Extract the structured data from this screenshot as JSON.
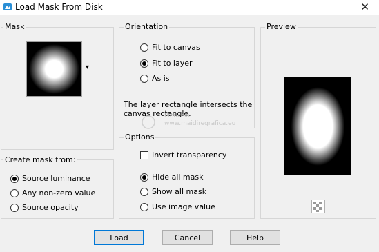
{
  "window": {
    "title": "Load Mask From Disk",
    "close_glyph": "✕"
  },
  "mask_group": {
    "label": "Mask",
    "dropdown_glyph": "▾"
  },
  "create_mask": {
    "label": "Create mask from:",
    "options": [
      {
        "label": "Source luminance",
        "selected": true
      },
      {
        "label": "Any non-zero value",
        "selected": false
      },
      {
        "label": "Source opacity",
        "selected": false
      }
    ]
  },
  "orientation": {
    "label": "Orientation",
    "options": [
      {
        "label": "Fit to canvas",
        "selected": false
      },
      {
        "label": "Fit to layer",
        "selected": true
      },
      {
        "label": "As is",
        "selected": false
      }
    ],
    "info_line1": "The layer rectangle intersects the",
    "info_line2": "canvas rectangle."
  },
  "options_group": {
    "label": "Options",
    "invert_label": "Invert transparency",
    "invert_checked": false,
    "radios": [
      {
        "label": "Hide all mask",
        "selected": true
      },
      {
        "label": "Show all mask",
        "selected": false
      },
      {
        "label": "Use image value",
        "selected": false
      }
    ]
  },
  "preview": {
    "label": "Preview"
  },
  "watermark": {
    "line1": "Pinuccia",
    "line2": "www.maidiregrafica.eu"
  },
  "buttons": {
    "load": "Load",
    "cancel": "Cancel",
    "help": "Help"
  },
  "colors": {
    "accent": "#0078d7",
    "background": "#f0f0f0"
  }
}
